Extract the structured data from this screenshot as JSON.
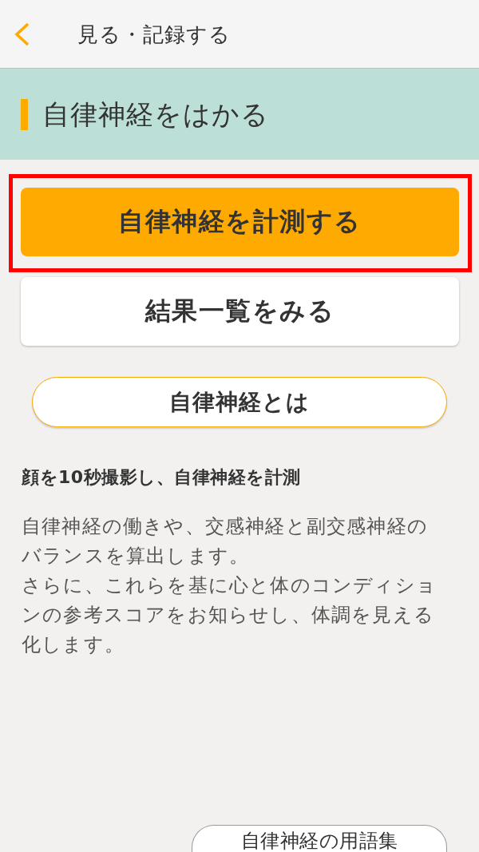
{
  "header": {
    "title": "見る・記録する"
  },
  "section": {
    "title": "自律神経をはかる"
  },
  "actions": [
    {
      "label": "自律神経を計測する",
      "kind": "primary",
      "highlighted": true
    },
    {
      "label": "結果一覧をみる",
      "kind": "secondary",
      "highlighted": false
    }
  ],
  "info_button": {
    "label": "自律神経とは"
  },
  "description": {
    "heading": "顔を10秒撮影し、自律神経を計測",
    "paragraphs": [
      "自律神経の働きや、交感神経と副交感神経のバランスを算出します。",
      "さらに、これらを基に心と体のコンディションの参考スコアをお知らせし、体調を見える化します。"
    ]
  },
  "glossary_button": {
    "label": "自律神経の用語集"
  }
}
